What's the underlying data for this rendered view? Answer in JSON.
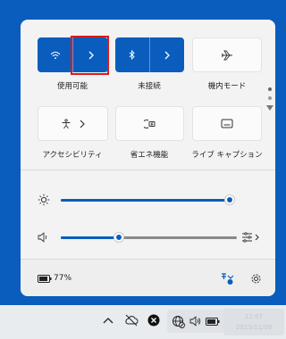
{
  "quick_settings": {
    "tiles": [
      {
        "label": "使用可能",
        "icon": "wifi-icon",
        "state": "on",
        "has_chevron": true
      },
      {
        "label": "未接続",
        "icon": "bluetooth-icon",
        "state": "on",
        "has_chevron": true
      },
      {
        "label": "機内モード",
        "icon": "airplane-icon",
        "state": "off",
        "has_chevron": false
      },
      {
        "label": "アクセシビリティ",
        "icon": "accessibility-icon",
        "state": "off",
        "has_chevron": true
      },
      {
        "label": "省エネ機能",
        "icon": "energy-saver-icon",
        "state": "off",
        "has_chevron": false
      },
      {
        "label": "ライブ キャプション",
        "icon": "live-caption-icon",
        "state": "off",
        "has_chevron": false
      }
    ],
    "page_indicator": {
      "pages": 2,
      "current": 1
    },
    "brightness": {
      "icon": "brightness-icon",
      "level": 1.0
    },
    "volume": {
      "icon": "speaker-icon",
      "level": 0.33,
      "mixer_icon": "volume-mixer-icon"
    },
    "battery": {
      "icon": "battery-icon",
      "percent_text": "77%"
    },
    "footer_icons": [
      "accessibility-settings-icon",
      "settings-icon"
    ]
  },
  "taskbar": {
    "tray_icons": [
      "chevron-up-icon",
      "cloud-offline-icon",
      "close-circle-icon",
      "network-icon",
      "speaker-icon",
      "battery-icon"
    ],
    "time": "12:07",
    "date": "2023/11/09"
  },
  "colors": {
    "accent": "#0a5dbd",
    "panel": "#f3f3f3",
    "highlight": "#e0191c"
  }
}
